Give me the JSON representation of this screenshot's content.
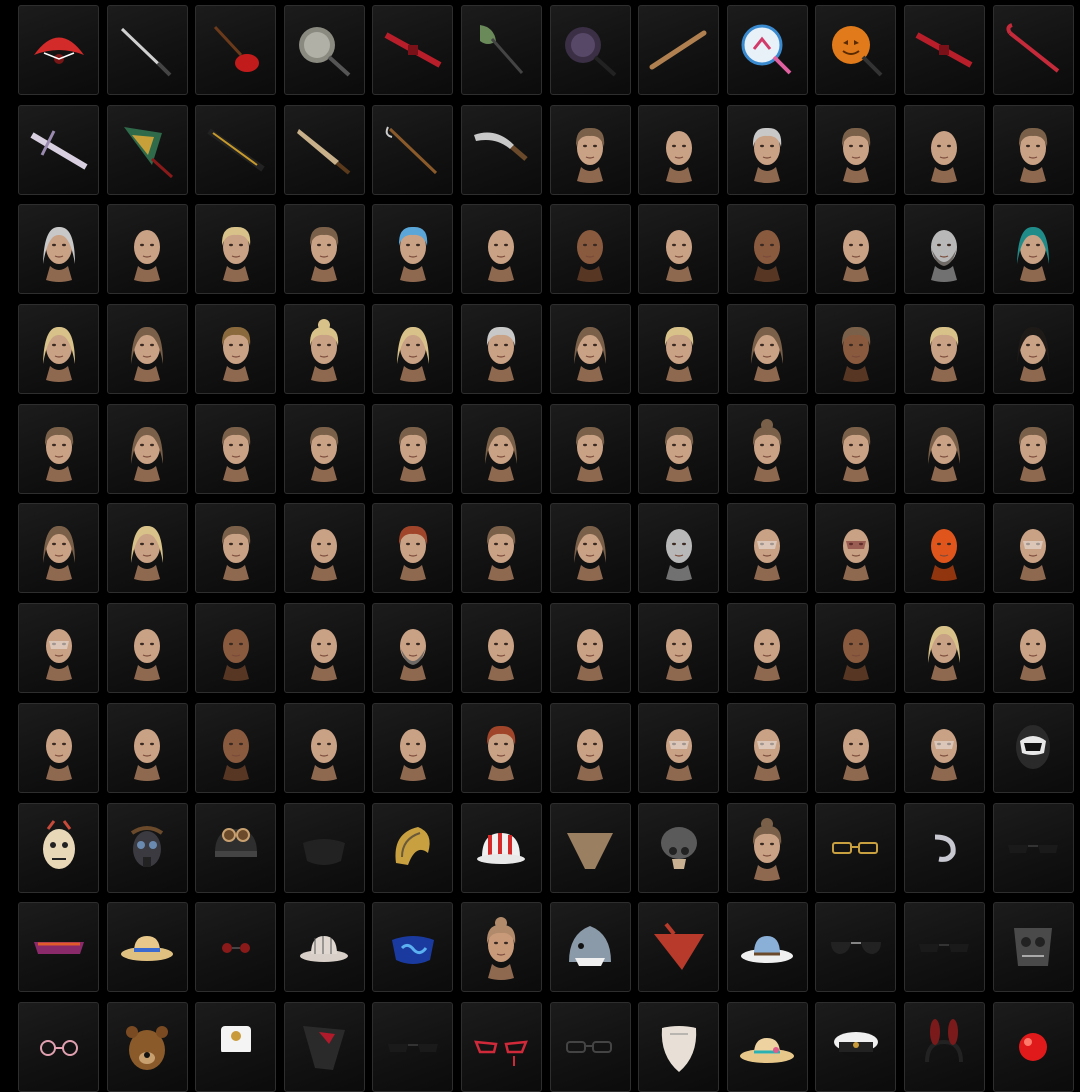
{
  "scroll_indicator": {
    "icon": "chevron-up-icon",
    "glyph": "^"
  },
  "colors": {
    "background": "#000000",
    "tile_bg": "#141414",
    "tile_border": "#2e2e2e"
  },
  "rows": [
    [
      "red-fan-icon",
      "katana-icon",
      "red-guitar-icon",
      "frying-pan-icon",
      "red-rifle-icon",
      "shovel-icon",
      "dark-pan-icon",
      "bat-icon",
      "candy-lollipop-icon",
      "pumpkin-pan-icon",
      "red-crossbow-icon",
      "crowbar-icon"
    ],
    [
      "white-crossbow-icon",
      "green-wing-weapon-icon",
      "gold-rifle-icon",
      "machete-icon",
      "sickle-icon",
      "kukri-icon",
      "hair-swept-icon",
      "head-buzzcut-icon",
      "hair-gray-short-icon",
      "hair-bowl-cut-icon",
      "head-bald-female-icon",
      "hair-undercut-icon"
    ],
    [
      "hair-white-bob-icon",
      "head-bald-female-icon",
      "hair-blonde-short-icon",
      "hair-brown-short-icon",
      "hair-blue-flower-icon",
      "head-bald-male-icon",
      "head-dark-female-icon",
      "head-bald-mustache-icon",
      "head-dark-male-icon",
      "head-bald-female-icon",
      "head-mannequin-bearded-icon",
      "hair-teal-bob-icon"
    ],
    [
      "hair-blonde-bob-icon",
      "hair-long-wavy-icon",
      "hair-leopard-short-icon",
      "hair-blonde-bun-icon",
      "hair-blonde-braid-icon",
      "hair-gray-swept-icon",
      "hair-long-wavy-icon",
      "hair-blonde-side-icon",
      "hair-braids-icon",
      "hair-curly-dark-icon",
      "hair-platinum-side-icon",
      "hair-black-bob-icon"
    ],
    [
      "hair-shaggy-icon",
      "hair-wavy-icon",
      "hair-messy-icon",
      "hair-fade-icon",
      "hair-tousled-icon",
      "hair-braid-icon",
      "hair-spiky-icon",
      "hair-slick-icon",
      "hair-topknot-icon",
      "hair-side-swept-icon",
      "hair-bob-icon",
      "hair-pompadour-icon"
    ],
    [
      "hair-bob-icon",
      "hair-blonde-bob-icon",
      "hair-bowl-cut-icon",
      "head-bald-male-icon",
      "head-redhead-icon",
      "hair-curly-icon",
      "hair-braid-crown-icon",
      "head-mannequin-icon",
      "head-facepaint-icon",
      "head-scarred-icon",
      "head-orange-mask-icon",
      "head-facepaint-icon"
    ],
    [
      "head-painted-female-icon",
      "head-bald-male-icon",
      "head-dark-male-icon",
      "head-bald-male-icon",
      "head-bearded-old-icon",
      "head-bald-male-icon",
      "head-bald-male-icon",
      "head-bald-male-icon",
      "head-bald-male-icon",
      "head-dark-male-icon",
      "hair-blonde-ponytail-icon",
      "head-bald-female-icon"
    ],
    [
      "head-bald-female-icon",
      "head-bald-female-icon",
      "head-dark-female-icon",
      "head-bald-female-icon",
      "head-bald-female-icon",
      "head-redhead-icon",
      "head-bald-female-icon",
      "head-makeup-female-icon",
      "head-makeup-female-icon",
      "head-bald-female-icon",
      "head-makeup-female-icon",
      "motorcycle-helmet-icon"
    ],
    [
      "scarecrow-mask-icon",
      "gas-mask-icon",
      "aviator-cap-icon",
      "face-mask-icon",
      "feather-headdress-icon",
      "striped-bucket-hat-icon",
      "bandana-mask-icon",
      "gas-mask-helmet-icon",
      "hair-updo-icon",
      "glasses-icon",
      "earpiece-icon",
      "sunglasses-icon"
    ],
    [
      "visor-sunglasses-icon",
      "straw-hat-icon",
      "round-sunglasses-icon",
      "plaid-fedora-icon",
      "blue-face-mask-icon",
      "bald-cap-icon",
      "shark-hat-icon",
      "red-bandana-icon",
      "sun-hat-icon",
      "aviator-sunglasses-icon",
      "thin-sunglasses-icon",
      "steampunk-mask-icon"
    ],
    [
      "pink-glasses-icon",
      "bear-mask-icon",
      "captain-hat-icon",
      "red-black-mask-icon",
      "dark-sunglasses-icon",
      "red-cat-eye-glasses-icon",
      "thin-glasses-icon",
      "white-beard-icon",
      "floral-sun-hat-icon",
      "naval-cap-icon",
      "bunny-ears-icon",
      "clown-nose-icon"
    ]
  ]
}
